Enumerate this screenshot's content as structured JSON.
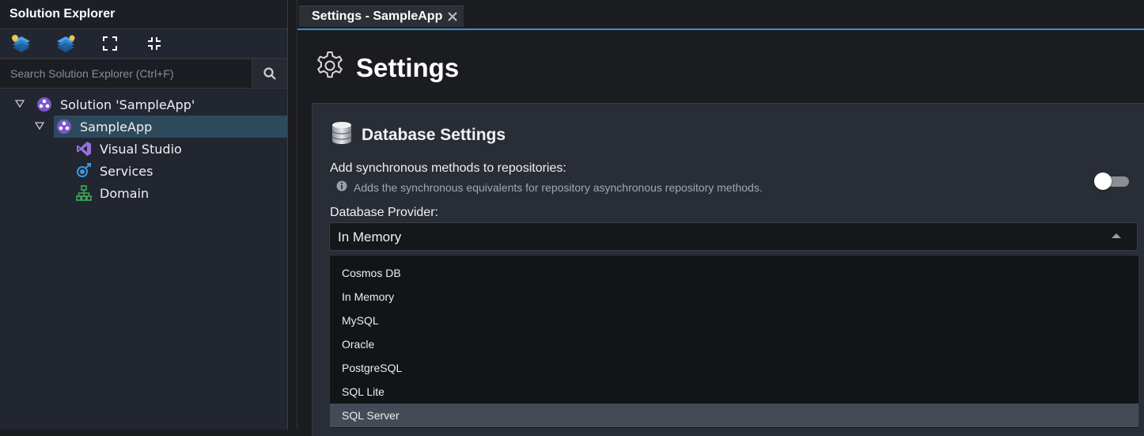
{
  "explorer": {
    "title": "Solution Explorer",
    "search_placeholder": "Search Solution Explorer (Ctrl+F)",
    "toolbar": [
      "add-layers-icon",
      "layers-icon",
      "expand-icon",
      "collapse-icon"
    ],
    "tree": {
      "solution": "Solution 'SampleApp'",
      "app": "SampleApp",
      "children": [
        "Visual Studio",
        "Services",
        "Domain"
      ]
    }
  },
  "tab": {
    "label": "Settings - SampleApp"
  },
  "settings": {
    "title": "Settings",
    "section_title": "Database Settings",
    "sync_label": "Add synchronous methods to repositories:",
    "sync_hint": "Adds the synchronous equivalents for repository asynchronous repository methods.",
    "sync_enabled": false,
    "provider_label": "Database Provider:",
    "provider_value": "In Memory",
    "provider_options": [
      "Cosmos DB",
      "In Memory",
      "MySQL",
      "Oracle",
      "PostgreSQL",
      "SQL Lite",
      "SQL Server"
    ],
    "highlighted_option": "SQL Server"
  },
  "colors": {
    "accent": "#3c8fcf",
    "selection": "#2d4a5c",
    "visual_studio": "#9b6ee0",
    "services": "#3c97e0",
    "domain": "#3bab5a"
  }
}
